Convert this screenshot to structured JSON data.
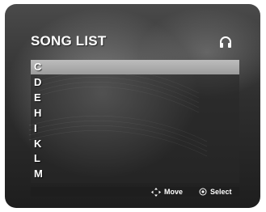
{
  "screen": {
    "title": "SONG LIST",
    "status_icon": "headphone-icon"
  },
  "list": {
    "items": [
      {
        "label": "C",
        "selected": true
      },
      {
        "label": "D",
        "selected": false
      },
      {
        "label": "E",
        "selected": false
      },
      {
        "label": "H",
        "selected": false
      },
      {
        "label": "I",
        "selected": false
      },
      {
        "label": "K",
        "selected": false
      },
      {
        "label": "L",
        "selected": false
      },
      {
        "label": "M",
        "selected": false
      }
    ]
  },
  "footer": {
    "move_label": "Move",
    "move_icon": "navigation-arrows-icon",
    "select_label": "Select",
    "select_icon": "select-button-icon"
  },
  "colors": {
    "highlight": "#a9a9a9",
    "text": "#ffffff"
  }
}
